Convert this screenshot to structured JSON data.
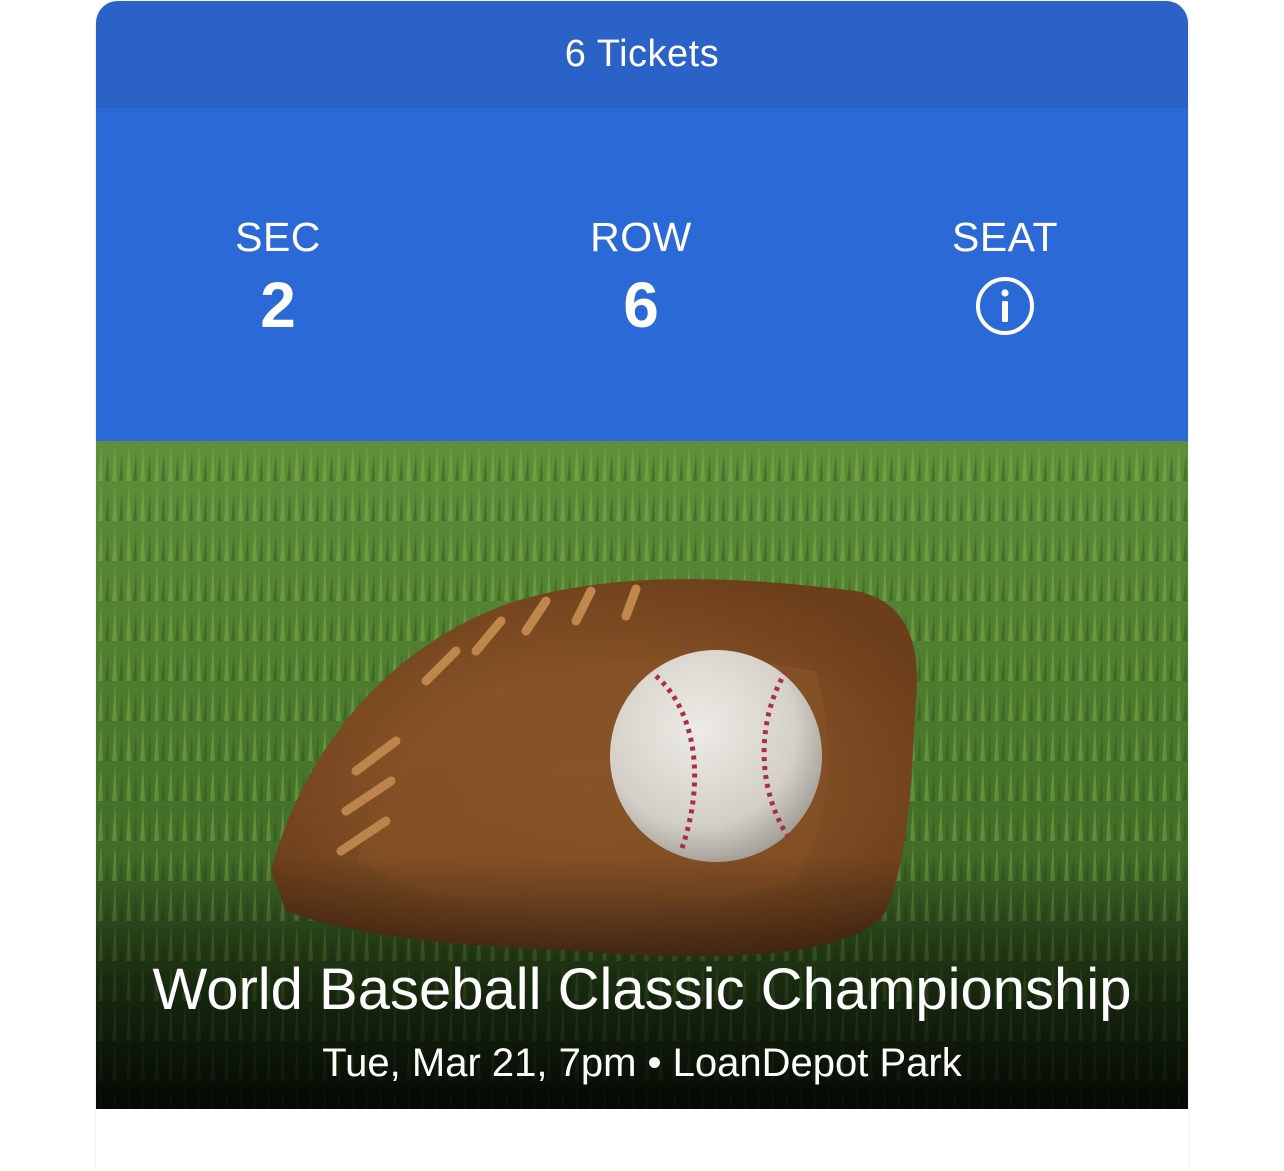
{
  "header": {
    "title": "6 Tickets"
  },
  "seating": {
    "sec_label": "SEC",
    "sec_value": "2",
    "row_label": "ROW",
    "row_value": "6",
    "seat_label": "SEAT",
    "seat_icon": "info-icon"
  },
  "event": {
    "name": "World Baseball Classic Championship",
    "details": "Tue, Mar 21, 7pm • LoanDepot Park"
  },
  "colors": {
    "header_bg": "#2a62c7",
    "band_bg": "#2b69d6",
    "text": "#ffffff"
  }
}
